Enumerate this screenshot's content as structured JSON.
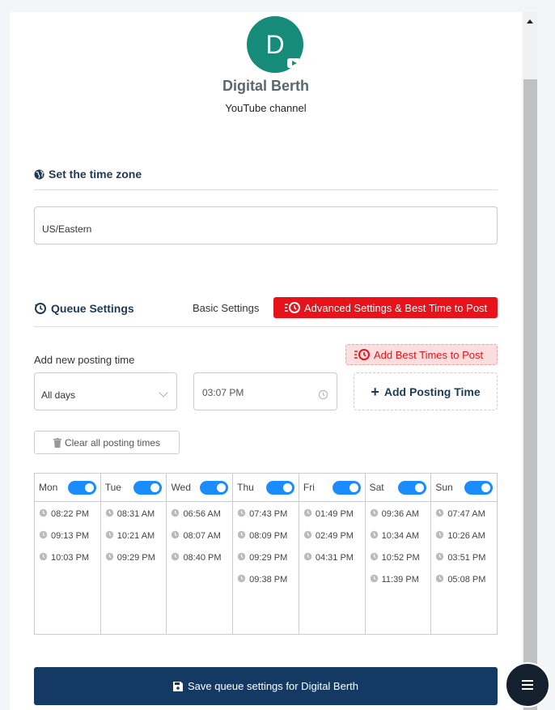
{
  "channel": {
    "initial": "D",
    "name": "Digital Berth",
    "type": "YouTube channel"
  },
  "timezone": {
    "title": "Set the time zone",
    "value": "US/Eastern"
  },
  "queue": {
    "title": "Queue Settings",
    "basic_label": "Basic Settings",
    "advanced_label": "Advanced Settings & Best Time to Post",
    "add_label": "Add new posting time",
    "best_label": "Add Best Times to Post",
    "day_select": "All days",
    "time_value": "03:07 PM",
    "add_time_label": "Add Posting Time",
    "clear_label": "Clear all posting times",
    "save_label": "Save queue settings for Digital Berth",
    "days": [
      {
        "name": "Mon",
        "enabled": true,
        "times": [
          "08:22 PM",
          "09:13 PM",
          "10:03 PM"
        ]
      },
      {
        "name": "Tue",
        "enabled": true,
        "times": [
          "08:31 AM",
          "10:21 AM",
          "09:29 PM"
        ]
      },
      {
        "name": "Wed",
        "enabled": true,
        "times": [
          "06:56 AM",
          "08:07 AM",
          "08:40 PM"
        ]
      },
      {
        "name": "Thu",
        "enabled": true,
        "times": [
          "07:43 PM",
          "08:09 PM",
          "09:29 PM",
          "09:38 PM"
        ]
      },
      {
        "name": "Fri",
        "enabled": true,
        "times": [
          "01:49 PM",
          "02:49 PM",
          "04:31 PM"
        ]
      },
      {
        "name": "Sat",
        "enabled": true,
        "times": [
          "09:36 AM",
          "10:34 AM",
          "10:52 PM",
          "11:39 PM"
        ]
      },
      {
        "name": "Sun",
        "enabled": true,
        "times": [
          "07:47 AM",
          "10:26 AM",
          "03:51 PM",
          "05:08 PM"
        ]
      }
    ]
  },
  "colors": {
    "brand_navy": "#143a63",
    "accent_red": "#e8131a",
    "toggle_blue": "#1a8cff",
    "avatar_teal": "#168b7a"
  }
}
